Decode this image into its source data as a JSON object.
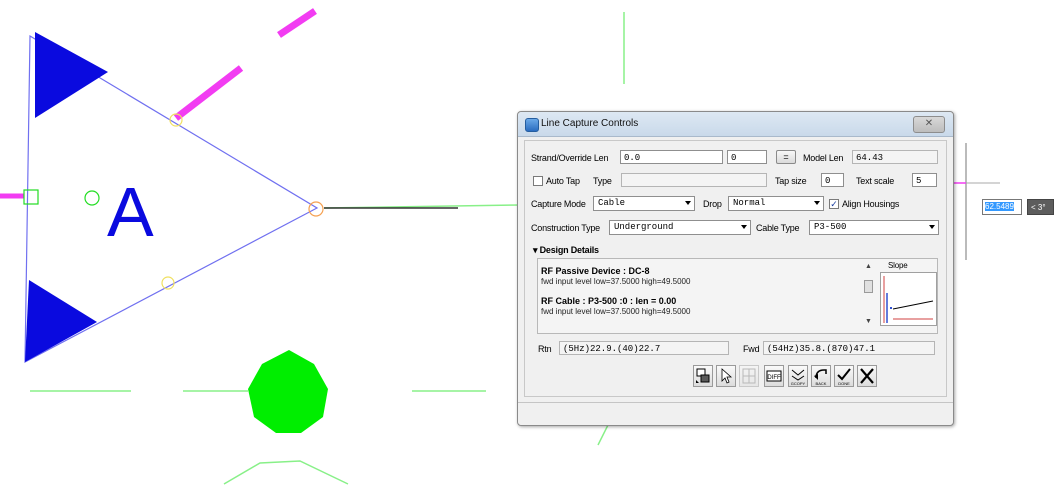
{
  "canvas": {
    "node_letter": "A",
    "colors": {
      "triangle": "#0a0adf",
      "edge": "#7070f0",
      "magenta": "#f23cf2",
      "green": "#22dd22",
      "light_green": "#88f088"
    }
  },
  "dialog": {
    "title": "Line Capture Controls",
    "close_label": "✕",
    "strand_label": "Strand/Override Len",
    "strand_value": "0.0",
    "strand_value2": "0",
    "equals_label": "=",
    "model_len_label": "Model Len",
    "model_len_value": "64.43",
    "auto_tap_label": "Auto Tap",
    "type_label": "Type",
    "type_value": "",
    "tap_size_label": "Tap size",
    "tap_size_value": "0",
    "text_scale_label": "Text scale",
    "text_scale_value": "5",
    "capture_mode_label": "Capture Mode",
    "capture_mode_value": "Cable",
    "drop_label": "Drop",
    "drop_value": "Normal",
    "align_housings_label": "Align Housings",
    "construction_type_label": "Construction Type",
    "construction_type_value": "Underground",
    "cable_type_label": "Cable Type",
    "cable_type_value": "P3-500",
    "design_details_label": "Design Details",
    "device_title": "RF Passive Device : DC-8",
    "device_levels": "fwd input level low=37.5000 high=49.5000",
    "cable_title": "RF Cable : P3-500 :0 : len = 0.00",
    "cable_levels": "fwd input level low=37.5000 high=49.5000",
    "slope_label": "Slope",
    "rtn_label": "Rtn",
    "rtn_value": "(5Hz)22.9.(40)22.7",
    "fwd_label": "Fwd",
    "fwd_value": "(54Hz)35.8.(870)47.1",
    "toolbar": {
      "diff_label": "DIFF",
      "gcopy_label": "GCOPY",
      "back_label": "BACK",
      "done_label": "DONE"
    }
  },
  "floating": {
    "input_value": "62.5489",
    "tag_value": "< 3°"
  }
}
